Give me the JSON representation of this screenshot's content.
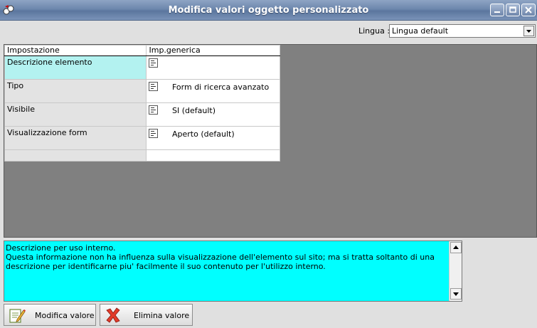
{
  "window": {
    "title": "Modifica valori oggetto personalizzato"
  },
  "language": {
    "label": "Lingua :",
    "selected": "Lingua default"
  },
  "grid": {
    "headers": [
      "Impostazione",
      "Imp.generica"
    ],
    "rows": [
      {
        "name": "Descrizione elemento",
        "value": ""
      },
      {
        "name": "Tipo",
        "value": "Form di ricerca avanzato"
      },
      {
        "name": "Visibile",
        "value": "SI (default)"
      },
      {
        "name": "Visualizzazione form",
        "value": "Aperto (default)"
      }
    ]
  },
  "description": {
    "line1": "Descrizione per uso interno.",
    "line2": "Questa informazione non ha influenza sulla visualizzazione dell'elemento sul sito; ma si tratta soltanto di una descrizione per identificarne piu' facilmente il suo contenuto per l'utilizzo interno."
  },
  "buttons": {
    "edit": "Modifica valore",
    "delete": "Elimina valore"
  },
  "colors": {
    "selected_row": "#b3f2f0",
    "description_bg": "#00ffff",
    "grid_background": "#808080"
  }
}
